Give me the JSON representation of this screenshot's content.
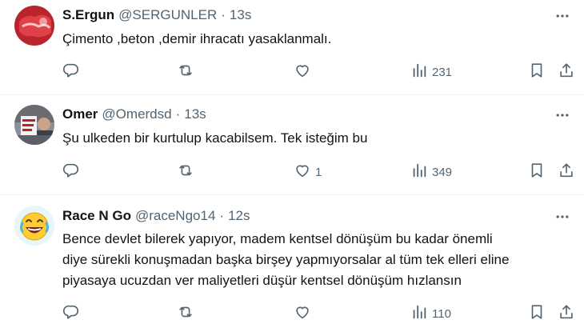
{
  "tweets": [
    {
      "name": "S.Ergun",
      "handle": "@SERGUNLER",
      "separator": "·",
      "time": "13s",
      "lines": [
        "Çimento ,beton  ,demir  ihracatı yasaklanmalı."
      ],
      "replies": "",
      "retweets": "",
      "likes": "",
      "views": "231"
    },
    {
      "name": "Omer",
      "handle": "@Omerdsd",
      "separator": "·",
      "time": "13s",
      "lines": [
        "Şu ulkeden bir kurtulup kacabilsem. Tek isteğim bu"
      ],
      "replies": "",
      "retweets": "",
      "likes": "1",
      "views": "349"
    },
    {
      "name": "Race N Go",
      "handle": "@raceNgo14",
      "separator": "·",
      "time": "12s",
      "lines": [
        "Bence devlet bilerek yapıyor, madem kentsel dönüşüm bu kadar önemli",
        "diye sürekli konuşmadan başka birşey yapmıyorsalar al tüm tek elleri eline",
        "piyasaya ucuzdan ver maliyetleri düşür kentsel dönüşüm hızlansın"
      ],
      "replies": "",
      "retweets": "",
      "likes": "",
      "views": "110"
    }
  ],
  "colors": {
    "text": "#0f1419",
    "secondary": "#536471",
    "divider": "#eff3f4"
  },
  "icons": [
    "reply-icon",
    "retweet-icon",
    "like-icon",
    "views-icon",
    "bookmark-icon",
    "share-icon",
    "more-icon"
  ]
}
